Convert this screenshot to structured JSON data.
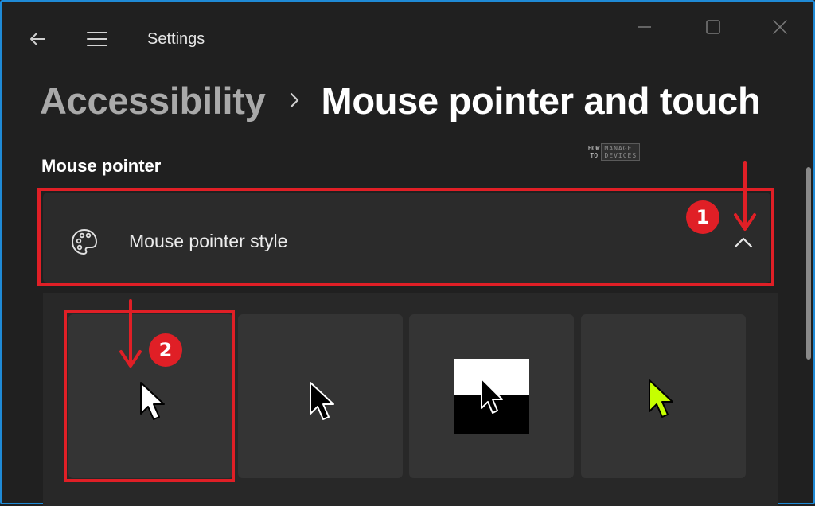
{
  "window": {
    "title": "Settings",
    "controls": [
      "minimize",
      "maximize",
      "close"
    ],
    "accent_border": "#1f8ad6"
  },
  "breadcrumb": {
    "parent": "Accessibility",
    "separator_icon": "chevron-right-icon",
    "current": "Mouse pointer and touch"
  },
  "section": {
    "title": "Mouse pointer"
  },
  "watermark": {
    "left_lines": [
      "HOW",
      "TO"
    ],
    "right_lines": [
      "MANAGE",
      "DEVICES"
    ]
  },
  "expander": {
    "icon": "palette-icon",
    "label": "Mouse pointer style",
    "state_icon": "chevron-up-icon",
    "expanded": true
  },
  "pointer_styles": [
    {
      "id": "white",
      "pointer_fill": "#ffffff",
      "selected": true
    },
    {
      "id": "black",
      "pointer_fill": "#000000",
      "selected": false
    },
    {
      "id": "inverted",
      "pointer_fill": "inverted",
      "selected": false
    },
    {
      "id": "custom",
      "pointer_fill": "#c6ff00",
      "selected": false
    }
  ],
  "annotations": [
    {
      "badge": "1",
      "color": "#e01f26"
    },
    {
      "badge": "2",
      "color": "#e01f26"
    }
  ]
}
